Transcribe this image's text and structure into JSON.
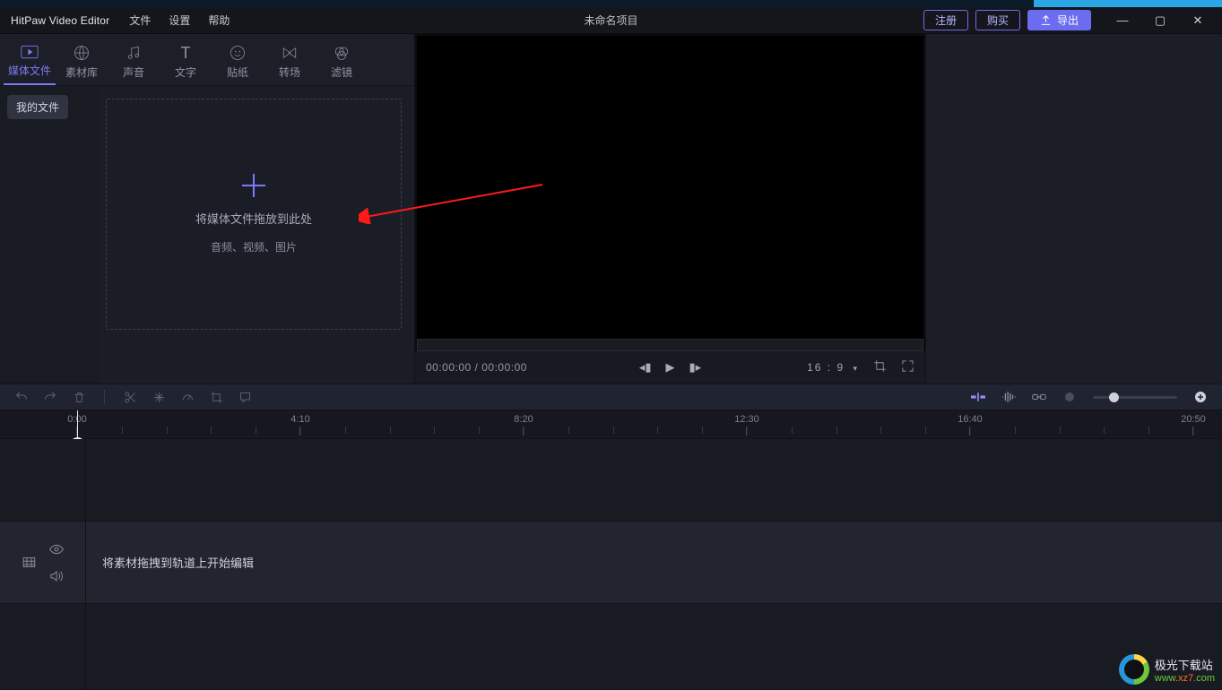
{
  "titlebar": {
    "brand": "HitPaw Video Editor",
    "menus": [
      "文件",
      "设置",
      "帮助"
    ],
    "project": "未命名项目",
    "register": "注册",
    "buy": "购买",
    "export": "导出"
  },
  "tabs": [
    {
      "key": "media",
      "label": "媒体文件"
    },
    {
      "key": "stock",
      "label": "素材库"
    },
    {
      "key": "audio",
      "label": "声音"
    },
    {
      "key": "text",
      "label": "文字"
    },
    {
      "key": "sticker",
      "label": "贴纸"
    },
    {
      "key": "trans",
      "label": "转场"
    },
    {
      "key": "filter",
      "label": "滤镜"
    }
  ],
  "left": {
    "myfiles": "我的文件",
    "drop_line1": "将媒体文件拖放到此处",
    "drop_line2": "音频、视频、图片"
  },
  "preview": {
    "current": "00:00:00",
    "total": "00:00:00",
    "sep": " / ",
    "ratio": "16 : 9",
    "ratio_caret": "▾"
  },
  "ruler": {
    "labels": [
      "0:00",
      "4:10",
      "8:20",
      "12:30",
      "16:40",
      "20:50"
    ]
  },
  "timeline": {
    "hint": "将素材拖拽到轨道上开始编辑"
  },
  "watermark": {
    "line1": "极光下载站",
    "line2_a": "www",
    "line2_b": ".xz7.",
    "line2_c": "com"
  },
  "colors": {
    "accent": "#7b7cf5"
  }
}
